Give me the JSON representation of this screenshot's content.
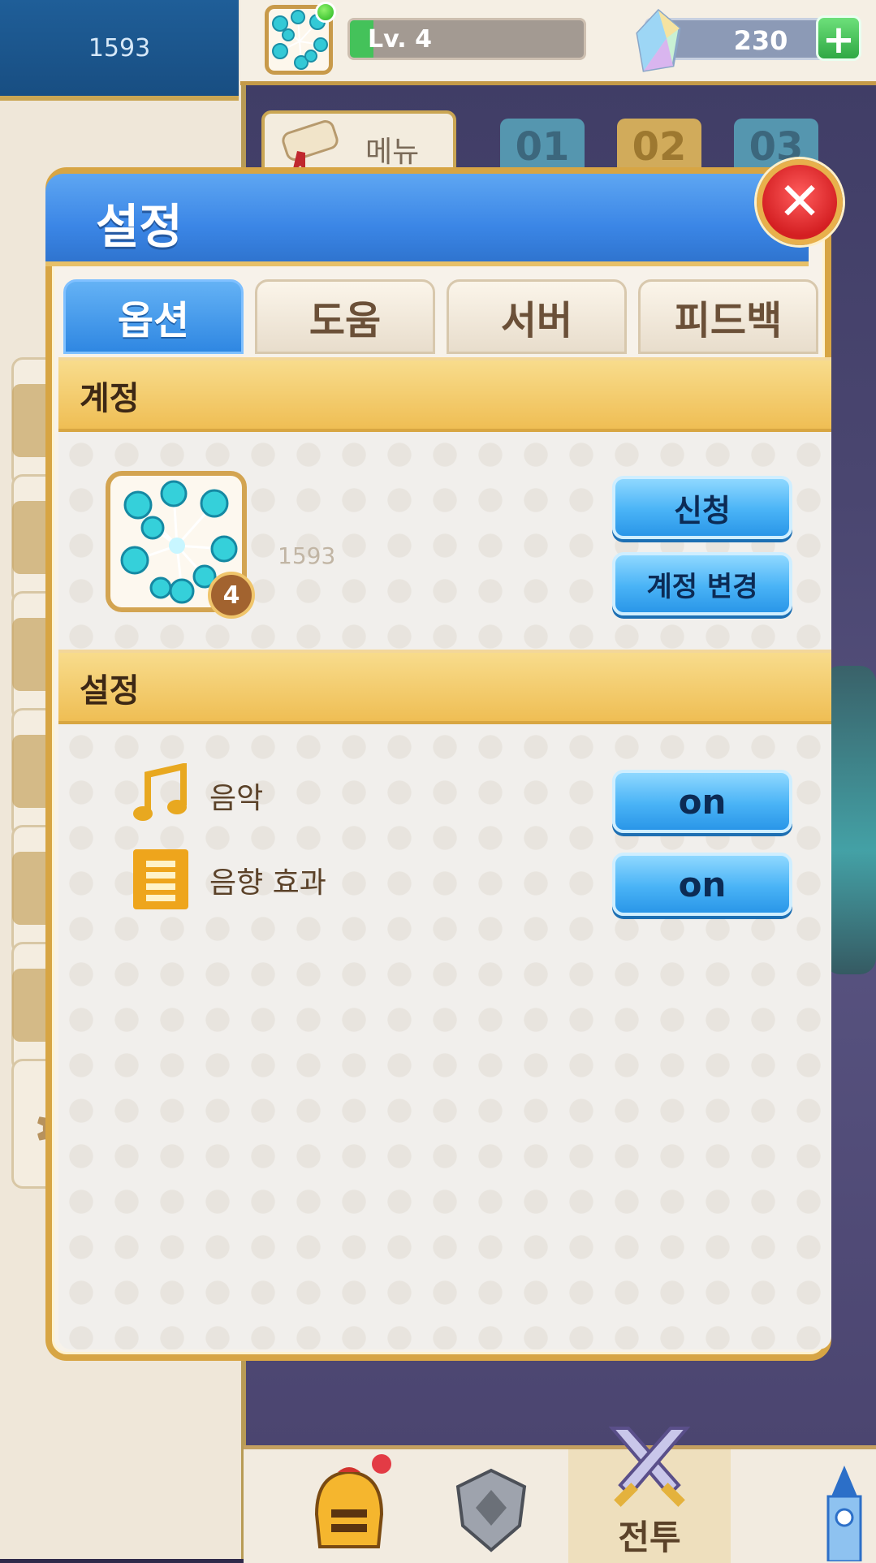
{
  "sidebar": {
    "header_value": "1593",
    "settings_label": "설정"
  },
  "hud": {
    "level": "Lv. 4",
    "level_progress": 0.1,
    "gems": "230",
    "plus": "+"
  },
  "background": {
    "menu_label": "메뉴",
    "stages": [
      "01",
      "02",
      "03"
    ]
  },
  "bottom_nav": {
    "battle_label": "전투"
  },
  "modal": {
    "title": "설정",
    "close": "✕",
    "tabs": [
      {
        "label": "옵션",
        "active": true
      },
      {
        "label": "도움",
        "active": false
      },
      {
        "label": "서버",
        "active": false
      },
      {
        "label": "피드백",
        "active": false
      }
    ],
    "account": {
      "section_title": "계정",
      "player_name": "1593",
      "level": "4",
      "apply_button": "신청",
      "change_account_button": "계정 변경"
    },
    "settings": {
      "section_title": "설정",
      "music_label": "음악",
      "music_toggle": "on",
      "sfx_label": "음향 효과",
      "sfx_toggle": "on"
    }
  },
  "colors": {
    "modal_header": "#3b86e6",
    "gold_border": "#d7a544",
    "section_gold": "#efbe54",
    "button_blue": "#49b3f6"
  }
}
